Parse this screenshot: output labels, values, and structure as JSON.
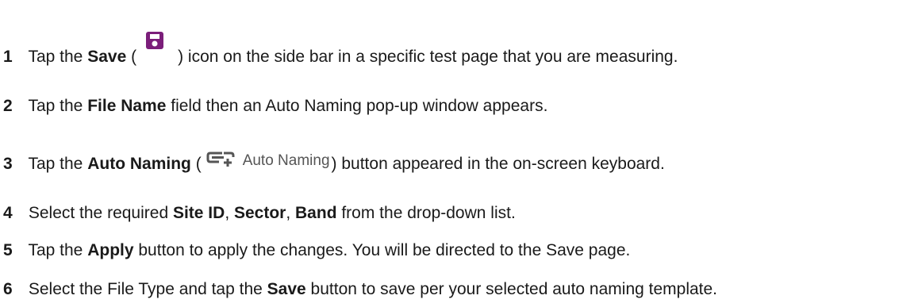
{
  "steps": [
    {
      "num": "1",
      "t1": "Tap the ",
      "b1": "Save",
      "t2": " (",
      "t3": ") icon on the side bar in a specific test page that you are measuring."
    },
    {
      "num": "2",
      "t1": "Tap the ",
      "b1": "File Name",
      "t2": " field then an Auto Naming pop-up window appears."
    },
    {
      "num": "3",
      "t1": "Tap the ",
      "b1": "Auto Naming",
      "t2": " (",
      "icon_label": "Auto Naming",
      "t3": ") button appeared in the on-screen keyboard."
    },
    {
      "num": "4",
      "t1": "Select the required ",
      "b1": "Site ID",
      "t2": ", ",
      "b2": "Sector",
      "t3": ", ",
      "b3": "Band",
      "t4": " from the drop-down list."
    },
    {
      "num": "5",
      "t1": "Tap the ",
      "b1": "Apply",
      "t2": " button to apply the changes. You will be directed to the Save page."
    },
    {
      "num": "6",
      "t1": "Select the File Type and tap the ",
      "b1": "Save",
      "t2": " button to save per your selected auto naming template."
    }
  ],
  "icons": {
    "save": "save-icon",
    "auto_naming": "auto-naming-icon"
  },
  "colors": {
    "save_icon": "#7b1e7a",
    "auto_naming_icon": "#555555"
  }
}
